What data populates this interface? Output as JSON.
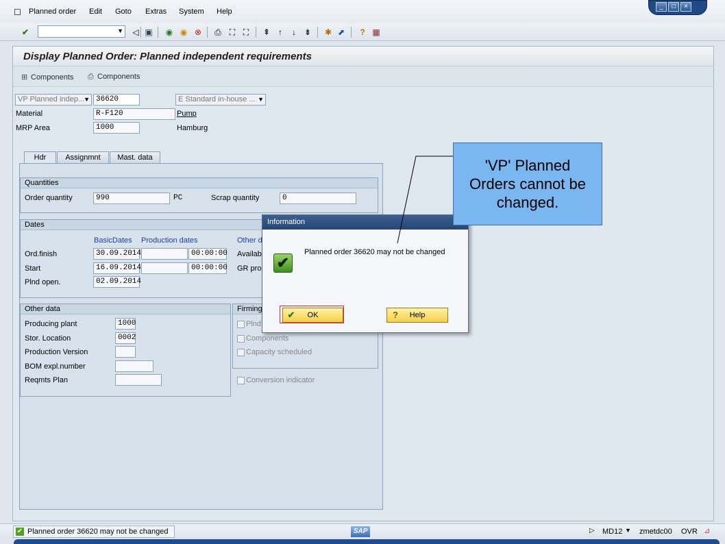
{
  "menu": {
    "icon": "menu-entry-icon",
    "items": [
      "Planned order",
      "Edit",
      "Goto",
      "Extras",
      "System",
      "Help"
    ]
  },
  "window_controls": [
    "minimize-icon",
    "restore-icon",
    "close-icon"
  ],
  "toolbar": {
    "icons": [
      "enter-check-icon",
      "back-icon",
      "save-icon",
      "back-nav-icon",
      "exit-icon",
      "cancel-icon",
      "print-icon",
      "find-icon",
      "find-next-icon",
      "first-page-icon",
      "previous-page-icon",
      "next-page-icon",
      "last-page-icon",
      "create-session-icon",
      "shortcut-icon",
      "help-icon",
      "layout-icon"
    ]
  },
  "title": "Display Planned Order: Planned independent requirements",
  "app_toolbar": {
    "btn1": "Components",
    "btn2": "Components"
  },
  "header": {
    "order_type": "VP Planned indep...",
    "order_number": "36620",
    "procurement": "E Standard in-house ...",
    "material_label": "Material",
    "material_value": "R-F120",
    "material_desc": "Pump",
    "mrp_area_label": "MRP Area",
    "mrp_area_value": "1000",
    "mrp_area_desc": "Hamburg"
  },
  "tabs": [
    "Hdr",
    "Assignmnt",
    "Mast. data"
  ],
  "quantities": {
    "title": "Quantities",
    "order_qty_label": "Order quantity",
    "order_qty_value": "990",
    "unit": "PC",
    "scrap_label": "Scrap quantity",
    "scrap_value": "0"
  },
  "dates": {
    "title": "Dates",
    "col_basic": "BasicDates",
    "col_prod": "Production dates",
    "col_other": "Other d",
    "ord_finish_label": "Ord.finish",
    "ord_finish_basic": "30.09.2014",
    "ord_finish_time": "00:00:00",
    "start_label": "Start",
    "start_basic": "16.09.2014",
    "start_time": "00:00:00",
    "plnd_open_label": "Plnd open.",
    "plnd_open_basic": "02.09.2014",
    "avail_label": "Availab",
    "gr_label": "GR proc"
  },
  "other_data": {
    "title": "Other data",
    "plant_label": "Producing plant",
    "plant_value": "1000",
    "stor_label": "Stor. Location",
    "stor_value": "0002",
    "prod_version_label": "Production Version",
    "bom_label": "BOM expl.number",
    "reqmts_label": "Reqmts Plan"
  },
  "firming": {
    "title": "Firming",
    "plnd_label": "Plnd",
    "components_label": "Components",
    "capacity_label": "Capacity scheduled",
    "conversion_label": "Conversion indicator"
  },
  "dialog": {
    "title": "Information",
    "message": "Planned order 36620 may not be changed",
    "ok_label": "OK",
    "help_label": "Help"
  },
  "callout": {
    "line1": "'VP' Planned",
    "line2": "Orders cannot be",
    "line3": "changed."
  },
  "status": {
    "message": "Planned order 36620 may not be changed",
    "logo": "SAP",
    "transaction": "MD12",
    "server": "zmetdc00",
    "mode": "OVR"
  }
}
